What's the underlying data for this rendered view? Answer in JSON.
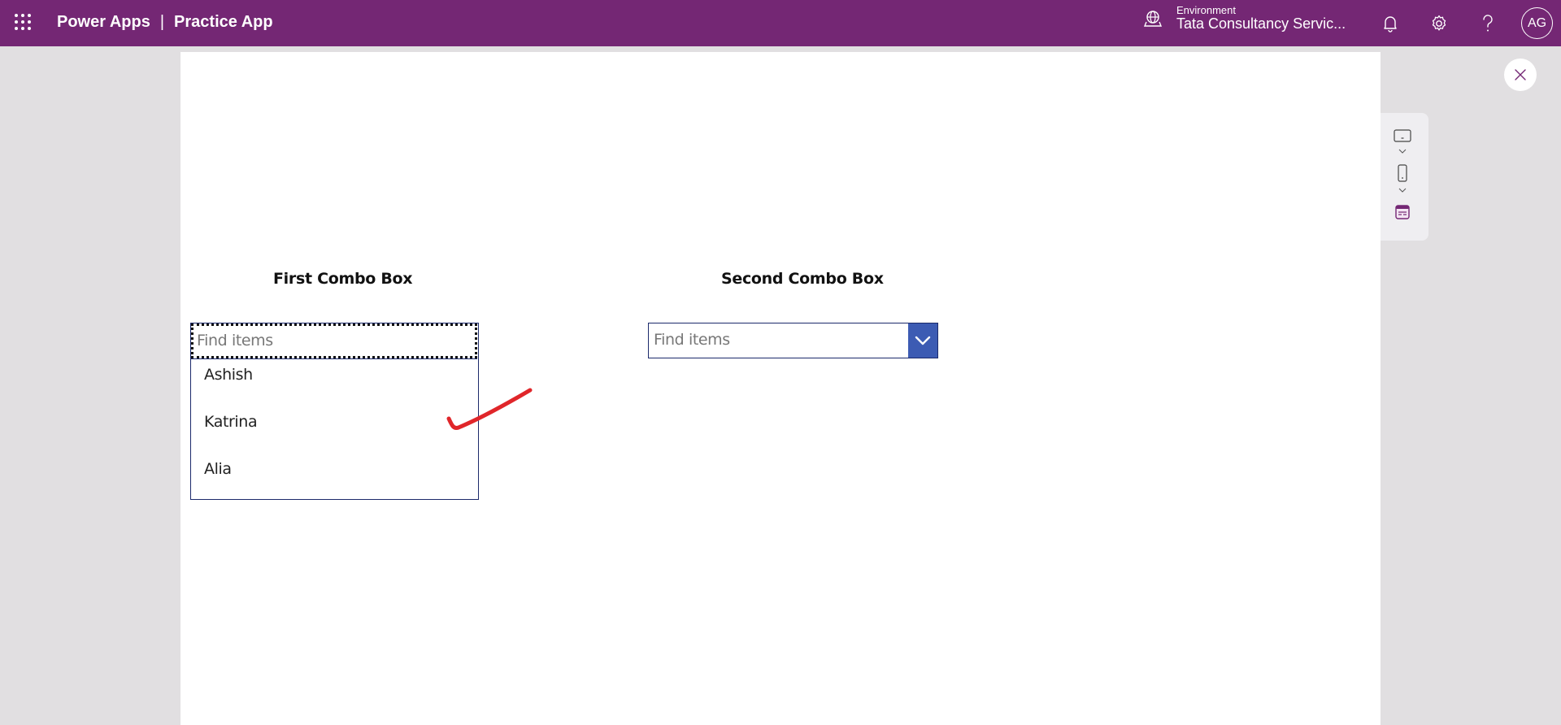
{
  "header": {
    "product": "Power Apps",
    "separator": "|",
    "app_name": "Practice App",
    "environment_label": "Environment",
    "environment_name": "Tata Consultancy Servic...",
    "avatar_initials": "AG",
    "icons": [
      "waffle-icon",
      "environment-globe-icon",
      "notification-bell-icon",
      "settings-gear-icon",
      "help-question-icon"
    ]
  },
  "canvas": {
    "first_label": "First Combo Box",
    "first_combo": {
      "placeholder": "Find items",
      "value": "",
      "items": [
        "Ashish",
        "Katrina",
        "Alia"
      ],
      "expanded": true
    },
    "second_label": "Second Combo Box",
    "second_combo": {
      "placeholder": "Find items",
      "value": "",
      "expanded": false
    },
    "annotation": "red-checkmark"
  },
  "side_panel": {
    "close_icon": "close-icon",
    "device_buttons": [
      "tablet-icon",
      "phone-icon",
      "fit-to-window-icon"
    ]
  },
  "colors": {
    "brand": "#742774",
    "combo_border": "#1c2a6b",
    "chevron_bg": "#3c5bb3",
    "annotation": "#e0262a"
  }
}
